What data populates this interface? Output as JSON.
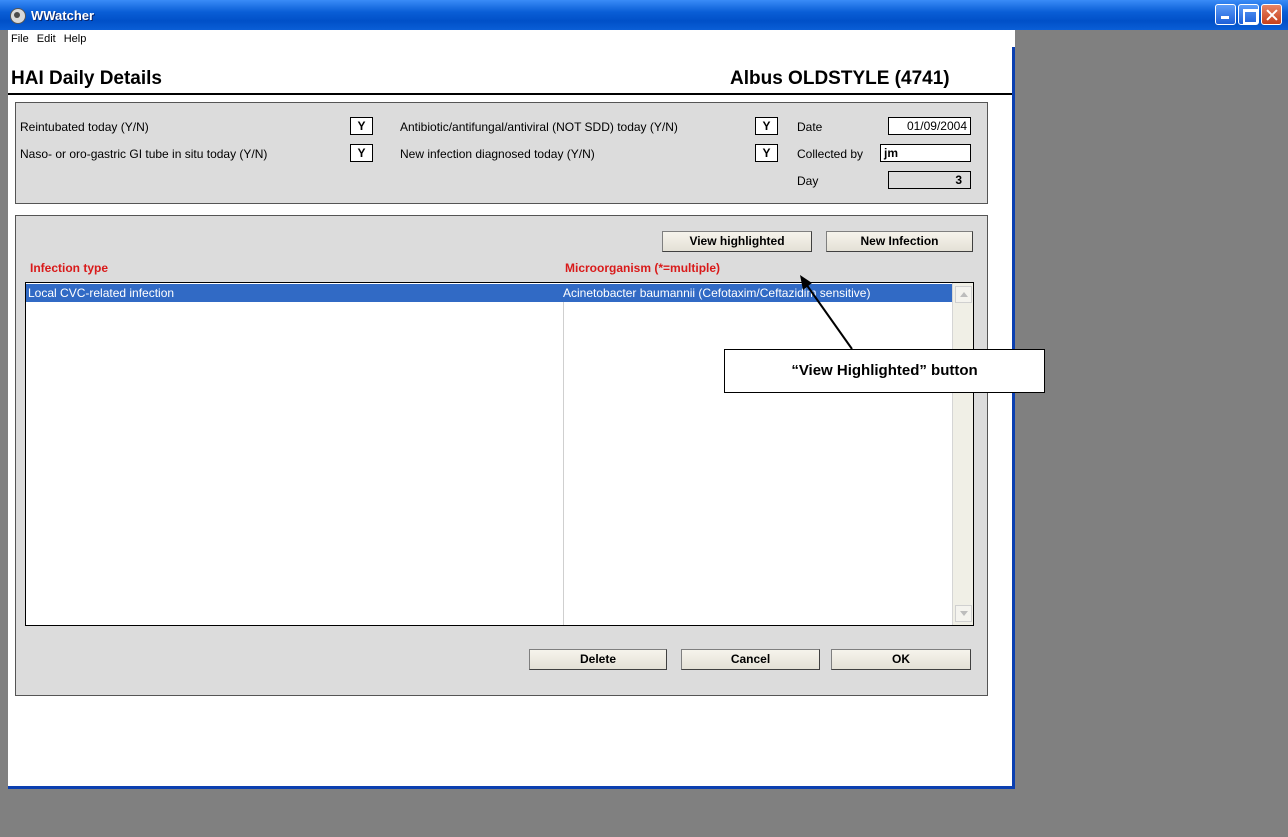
{
  "window": {
    "title": "WWatcher"
  },
  "menu": {
    "items": [
      "File",
      "Edit",
      "Help"
    ]
  },
  "header": {
    "title": "HAI Daily Details",
    "patient": "Albus OLDSTYLE (4741)"
  },
  "daily_form": {
    "reintubated": {
      "label": "Reintubated today (Y/N)",
      "value": "Y"
    },
    "gi_tube": {
      "label": "Naso- or oro-gastric GI tube in situ today (Y/N)",
      "value": "Y"
    },
    "antibiotic": {
      "label": "Antibiotic/antifungal/antiviral (NOT SDD) today (Y/N)",
      "value": "Y"
    },
    "new_infection": {
      "label": "New infection diagnosed today (Y/N)",
      "value": "Y"
    },
    "date": {
      "label": "Date",
      "value": "01/09/2004"
    },
    "collected_by": {
      "label": "Collected by",
      "value": "jm"
    },
    "day": {
      "label": "Day",
      "value": "3"
    }
  },
  "infections": {
    "view_highlighted_label": "View highlighted",
    "new_infection_label": "New Infection",
    "col_infection_type": "Infection type",
    "col_microorganism": "Microorganism (*=multiple)",
    "rows": [
      {
        "infection_type": "Local CVC-related infection",
        "microorganism": "Acinetobacter baumannii (Cefotaxim/Ceftazidim sensitive)"
      }
    ]
  },
  "actions": {
    "delete_label": "Delete",
    "cancel_label": "Cancel",
    "ok_label": "OK"
  },
  "annotation": {
    "text": "“View Highlighted” button"
  }
}
